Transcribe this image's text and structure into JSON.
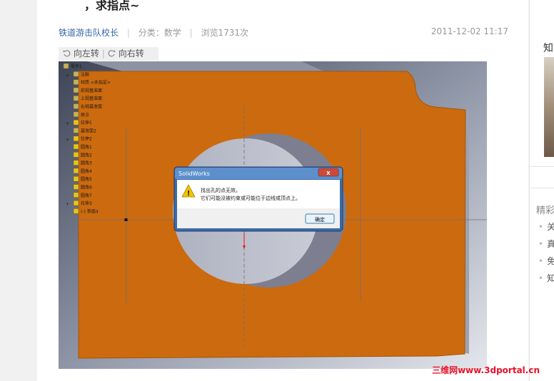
{
  "question": {
    "title_tail": "，求指点~"
  },
  "meta": {
    "author": "铁道游击队校长",
    "category_label": "分类：数学",
    "views_label": "浏览1731次",
    "datetime": "2011-12-02 11:17"
  },
  "image_toolbar": {
    "rotate_left": "向左转",
    "rotate_right": "向右转"
  },
  "solidworks": {
    "feature_tree": [
      "零件1",
      "注解",
      "材质 <未指定>",
      "前视基准面",
      "上视基准面",
      "右视基准面",
      "原点",
      "拉伸1",
      "基准面2",
      "拉伸2",
      "圆角1",
      "圆角2",
      "圆角3",
      "圆角4",
      "圆角5",
      "圆角6",
      "圆角7",
      "拉伸3",
      "(-) 草图4"
    ],
    "dialog": {
      "title": "SolidWorks",
      "message_line1": "找出孔的点无效。",
      "message_line2": "它们可能没被约束或可能位于边线或顶点上。",
      "ok_label": "确定",
      "close_label": "X"
    }
  },
  "sidebar": {
    "section_initial": "知",
    "featured_initial": "精彩",
    "items": [
      "关",
      "真",
      "免",
      "知"
    ]
  },
  "watermark": "三维网www.3dportal.cn",
  "colors": {
    "part_orange": "#cc6a0f",
    "link_blue": "#3366aa",
    "watermark_red": "#e8102a",
    "dialog_blue": "#4a7ab8"
  }
}
